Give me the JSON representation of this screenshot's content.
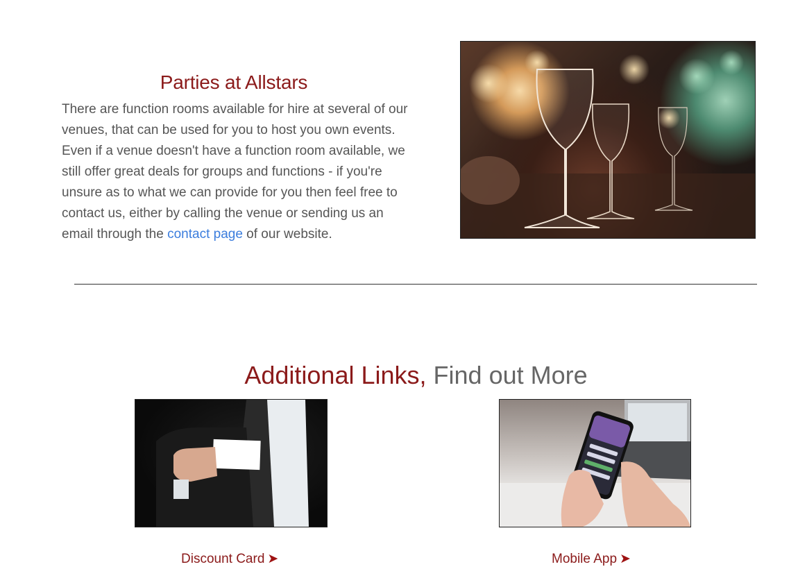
{
  "parties": {
    "title": "Parties at Allstars",
    "text_before": "There are function rooms available for hire at several of our venues, that can be used for you to host you own events. Even if a venue doesn't have a function room available, we still offer great deals for groups and functions - if you're unsure as to what we can provide for you then feel free to contact us, either by calling the venue or sending us an email through the ",
    "link_text": "contact page",
    "text_after": " of our website.",
    "image_icon": "wine-glass-photo"
  },
  "additional": {
    "title_accent": "Additional Links,",
    "title_rest": " Find out More",
    "items": [
      {
        "label": "Discount Card",
        "arrow": "➤",
        "image_icon": "business-card-photo"
      },
      {
        "label": "Mobile App",
        "arrow": "➤",
        "image_icon": "smartphone-photo"
      }
    ]
  },
  "colors": {
    "accent": "#8b1a1a",
    "link": "#3b7ddd",
    "body_text": "#555555"
  }
}
